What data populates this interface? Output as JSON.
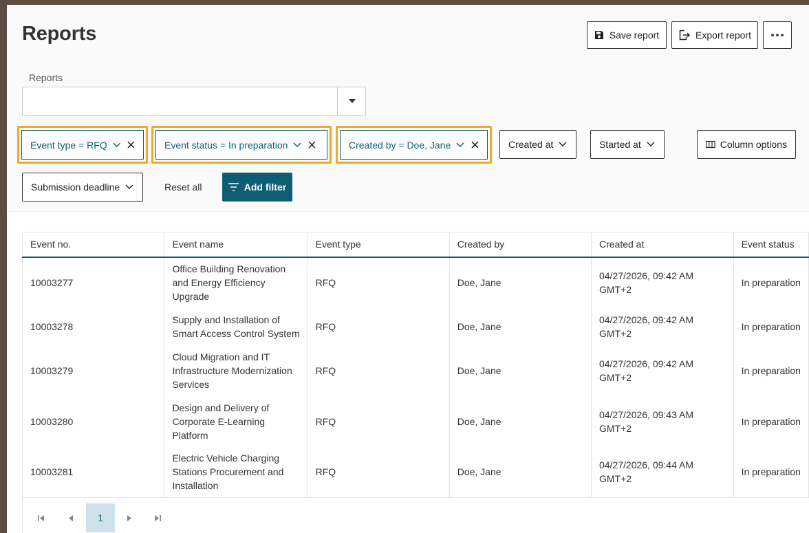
{
  "page": {
    "title": "Reports"
  },
  "header_buttons": {
    "save": "Save report",
    "export": "Export report"
  },
  "reports_select": {
    "label": "Reports",
    "value": ""
  },
  "active_filters": [
    {
      "label": "Event type = RFQ"
    },
    {
      "label": "Event status = In preparation"
    },
    {
      "label": "Created by = Doe, Jane"
    }
  ],
  "filter_buttons": {
    "created_at": "Created at",
    "started_at": "Started at",
    "column_options": "Column options",
    "submission_deadline": "Submission deadline",
    "reset_all": "Reset all",
    "add_filter": "Add filter"
  },
  "table": {
    "columns": [
      "Event no.",
      "Event name",
      "Event type",
      "Created by",
      "Created at",
      "Event status"
    ],
    "rows": [
      {
        "event_no": "10003277",
        "event_name_lines": [
          "Office Building Renovation",
          "and Energy Efficiency",
          "Upgrade"
        ],
        "event_type": "RFQ",
        "created_by": "Doe, Jane",
        "created_at_lines": [
          "04/27/2026, 09:42 AM",
          "GMT+2"
        ],
        "status": "In preparation"
      },
      {
        "event_no": "10003278",
        "event_name_lines": [
          "Supply and Installation of",
          "Smart Access Control System"
        ],
        "event_type": "RFQ",
        "created_by": "Doe, Jane",
        "created_at_lines": [
          "04/27/2026, 09:42 AM",
          "GMT+2"
        ],
        "status": "In preparation"
      },
      {
        "event_no": "10003279",
        "event_name_lines": [
          "Cloud Migration and IT",
          "Infrastructure Modernization",
          "Services"
        ],
        "event_type": "RFQ",
        "created_by": "Doe, Jane",
        "created_at_lines": [
          "04/27/2026, 09:42 AM",
          "GMT+2"
        ],
        "status": "In preparation"
      },
      {
        "event_no": "10003280",
        "event_name_lines": [
          "Design and Delivery of",
          "Corporate E-Learning",
          "Platform"
        ],
        "event_type": "RFQ",
        "created_by": "Doe, Jane",
        "created_at_lines": [
          "04/27/2026, 09:43 AM",
          "GMT+2"
        ],
        "status": "In preparation"
      },
      {
        "event_no": "10003281",
        "event_name_lines": [
          "Electric Vehicle Charging",
          "Stations Procurement and",
          "Installation"
        ],
        "event_type": "RFQ",
        "created_by": "Doe, Jane",
        "created_at_lines": [
          "04/27/2026, 09:44 AM",
          "GMT+2"
        ],
        "status": "In preparation"
      }
    ]
  },
  "pagination": {
    "current_page": "1"
  },
  "colors": {
    "accent": "#0d5e73",
    "highlight": "#f0a92c",
    "active_page_bg": "#cfe2ea"
  }
}
